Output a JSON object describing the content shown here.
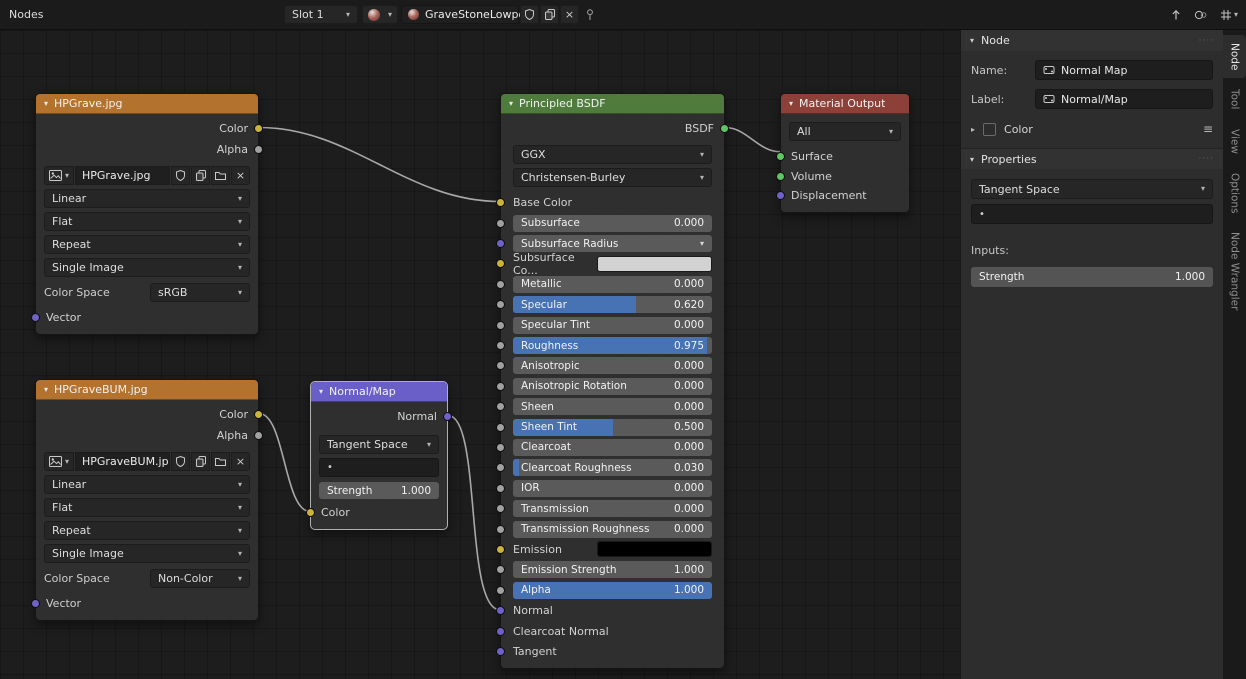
{
  "icons": {
    "collapse_triangle": "▾",
    "expand_triangle": "▸",
    "dropdown_chevron": "▾",
    "close": "×",
    "dot": "•",
    "grip": "····",
    "menu_lines": "≡"
  },
  "colors": {
    "texture_header": "#b4722f",
    "vector_header": "#6a5ec8",
    "shader_header": "#4f7c3c",
    "output_header": "#8c4038",
    "slider_fill": "#4772b3",
    "socket_color": "#ccb33c",
    "socket_value": "#a1a1a1",
    "socket_vector": "#6e62c9",
    "socket_shader": "#5fc75f",
    "wire": "#a8a8a8"
  },
  "header": {
    "editor": "Nodes",
    "slot": "Slot 1",
    "material_name": "GraveStoneLowpoly"
  },
  "nodes": {
    "hpgrave": {
      "title": "HPGrave.jpg",
      "outputs": [
        {
          "label": "Color",
          "socket": "color"
        },
        {
          "label": "Alpha",
          "socket": "value"
        }
      ],
      "image_name": "HPGrave.jpg",
      "interpolation": "Linear",
      "projection": "Flat",
      "extension": "Repeat",
      "source": "Single Image",
      "color_space_label": "Color Space",
      "color_space_value": "sRGB",
      "input_label": "Vector"
    },
    "hpgravebum": {
      "title": "HPGraveBUM.jpg",
      "outputs": [
        {
          "label": "Color",
          "socket": "color"
        },
        {
          "label": "Alpha",
          "socket": "value"
        }
      ],
      "image_name": "HPGraveBUM.jpg",
      "interpolation": "Linear",
      "projection": "Flat",
      "extension": "Repeat",
      "source": "Single Image",
      "color_space_label": "Color Space",
      "color_space_value": "Non-Color",
      "input_label": "Vector"
    },
    "normalmap": {
      "title": "Normal/Map",
      "output_label": "Normal",
      "space": "Tangent Space",
      "uv_map": "•",
      "strength_label": "Strength",
      "strength_value": "1.000",
      "input_label": "Color"
    },
    "principled": {
      "title": "Principled BSDF",
      "output_label": "BSDF",
      "distribution": "GGX",
      "subsurface_method": "Christensen-Burley",
      "base_color_label": "Base Color",
      "params": [
        {
          "label": "Subsurface",
          "value": "0.000",
          "type": "slider",
          "fill": 0,
          "socket": "value"
        },
        {
          "label": "Subsurface Radius",
          "type": "dropdown",
          "socket": "vector"
        },
        {
          "label": "Subsurface Co...",
          "type": "color",
          "swatch": "#d2d2d2",
          "socket": "color"
        },
        {
          "label": "Metallic",
          "value": "0.000",
          "type": "slider",
          "fill": 0,
          "socket": "value"
        },
        {
          "label": "Specular",
          "value": "0.620",
          "type": "slider",
          "fill": 0.62,
          "socket": "value"
        },
        {
          "label": "Specular Tint",
          "value": "0.000",
          "type": "slider",
          "fill": 0,
          "socket": "value"
        },
        {
          "label": "Roughness",
          "value": "0.975",
          "type": "slider",
          "fill": 0.975,
          "socket": "value"
        },
        {
          "label": "Anisotropic",
          "value": "0.000",
          "type": "slider",
          "fill": 0,
          "socket": "value"
        },
        {
          "label": "Anisotropic Rotation",
          "value": "0.000",
          "type": "slider",
          "fill": 0,
          "socket": "value"
        },
        {
          "label": "Sheen",
          "value": "0.000",
          "type": "slider",
          "fill": 0,
          "socket": "value"
        },
        {
          "label": "Sheen Tint",
          "value": "0.500",
          "type": "slider",
          "fill": 0.5,
          "socket": "value"
        },
        {
          "label": "Clearcoat",
          "value": "0.000",
          "type": "slider",
          "fill": 0,
          "socket": "value"
        },
        {
          "label": "Clearcoat Roughness",
          "value": "0.030",
          "type": "slider",
          "fill": 0.03,
          "socket": "value"
        },
        {
          "label": "IOR",
          "value": "0.000",
          "type": "slider",
          "fill": 0,
          "socket": "value"
        },
        {
          "label": "Transmission",
          "value": "0.000",
          "type": "slider",
          "fill": 0,
          "socket": "value"
        },
        {
          "label": "Transmission Roughness",
          "value": "0.000",
          "type": "slider",
          "fill": 0,
          "socket": "value"
        },
        {
          "label": "Emission",
          "type": "color",
          "swatch": "#000000",
          "socket": "color"
        },
        {
          "label": "Emission Strength",
          "value": "1.000",
          "type": "slider",
          "fill": 0,
          "socket": "value"
        },
        {
          "label": "Alpha",
          "value": "1.000",
          "type": "slider",
          "fill": 1,
          "socket": "value"
        },
        {
          "label": "Normal",
          "type": "socket-label",
          "socket": "vector"
        },
        {
          "label": "Clearcoat Normal",
          "type": "socket-label",
          "socket": "vector"
        },
        {
          "label": "Tangent",
          "type": "socket-label",
          "socket": "vector"
        }
      ]
    },
    "material_output": {
      "title": "Material Output",
      "target": "All",
      "inputs": [
        {
          "label": "Surface",
          "socket": "shader"
        },
        {
          "label": "Volume",
          "socket": "shader"
        },
        {
          "label": "Displacement",
          "socket": "vector"
        }
      ]
    }
  },
  "sidebar": {
    "node_panel": {
      "title": "Node",
      "name_label": "Name:",
      "name_value": "Normal Map",
      "label_label": "Label:",
      "label_value": "Normal/Map",
      "color_label": "Color"
    },
    "properties_panel": {
      "title": "Properties",
      "space": "Tangent Space",
      "uv_map": "•",
      "inputs_label": "Inputs:",
      "strength_label": "Strength",
      "strength_value": "1.000"
    },
    "tabs": [
      {
        "label": "Node",
        "active": true
      },
      {
        "label": "Tool",
        "active": false
      },
      {
        "label": "View",
        "active": false
      },
      {
        "label": "Options",
        "active": false
      },
      {
        "label": "Node Wrangler",
        "active": false
      }
    ]
  }
}
